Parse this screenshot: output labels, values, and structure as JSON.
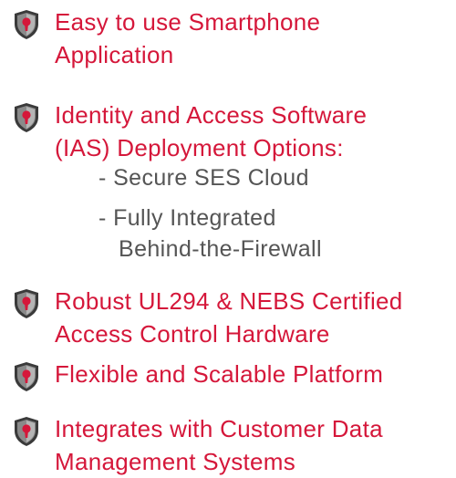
{
  "colors": {
    "accent": "#d5173a",
    "shield_dark": "#3a3a3a",
    "shield_mid": "#8a8a8a",
    "text_gray": "#555555"
  },
  "items": [
    {
      "icon": "shield-icon",
      "line1": "Easy to use Smartphone",
      "line2": "Application"
    },
    {
      "icon": "shield-icon",
      "line1": "Identity and Access Software",
      "line2": "(IAS) Deployment Options:"
    },
    {
      "icon": "shield-icon",
      "line1": "Robust UL294 & NEBS Certified",
      "line2": "Access Control Hardware"
    },
    {
      "icon": "shield-icon",
      "line1": "Flexible and Scalable Platform",
      "line2": ""
    },
    {
      "icon": "shield-icon",
      "line1": "Integrates with Customer Data",
      "line2": "Management Systems"
    }
  ],
  "deployment_options": [
    {
      "line1": "- Secure SES Cloud",
      "line2": ""
    },
    {
      "line1": "- Fully Integrated",
      "line2": "Behind-the-Firewall"
    }
  ]
}
